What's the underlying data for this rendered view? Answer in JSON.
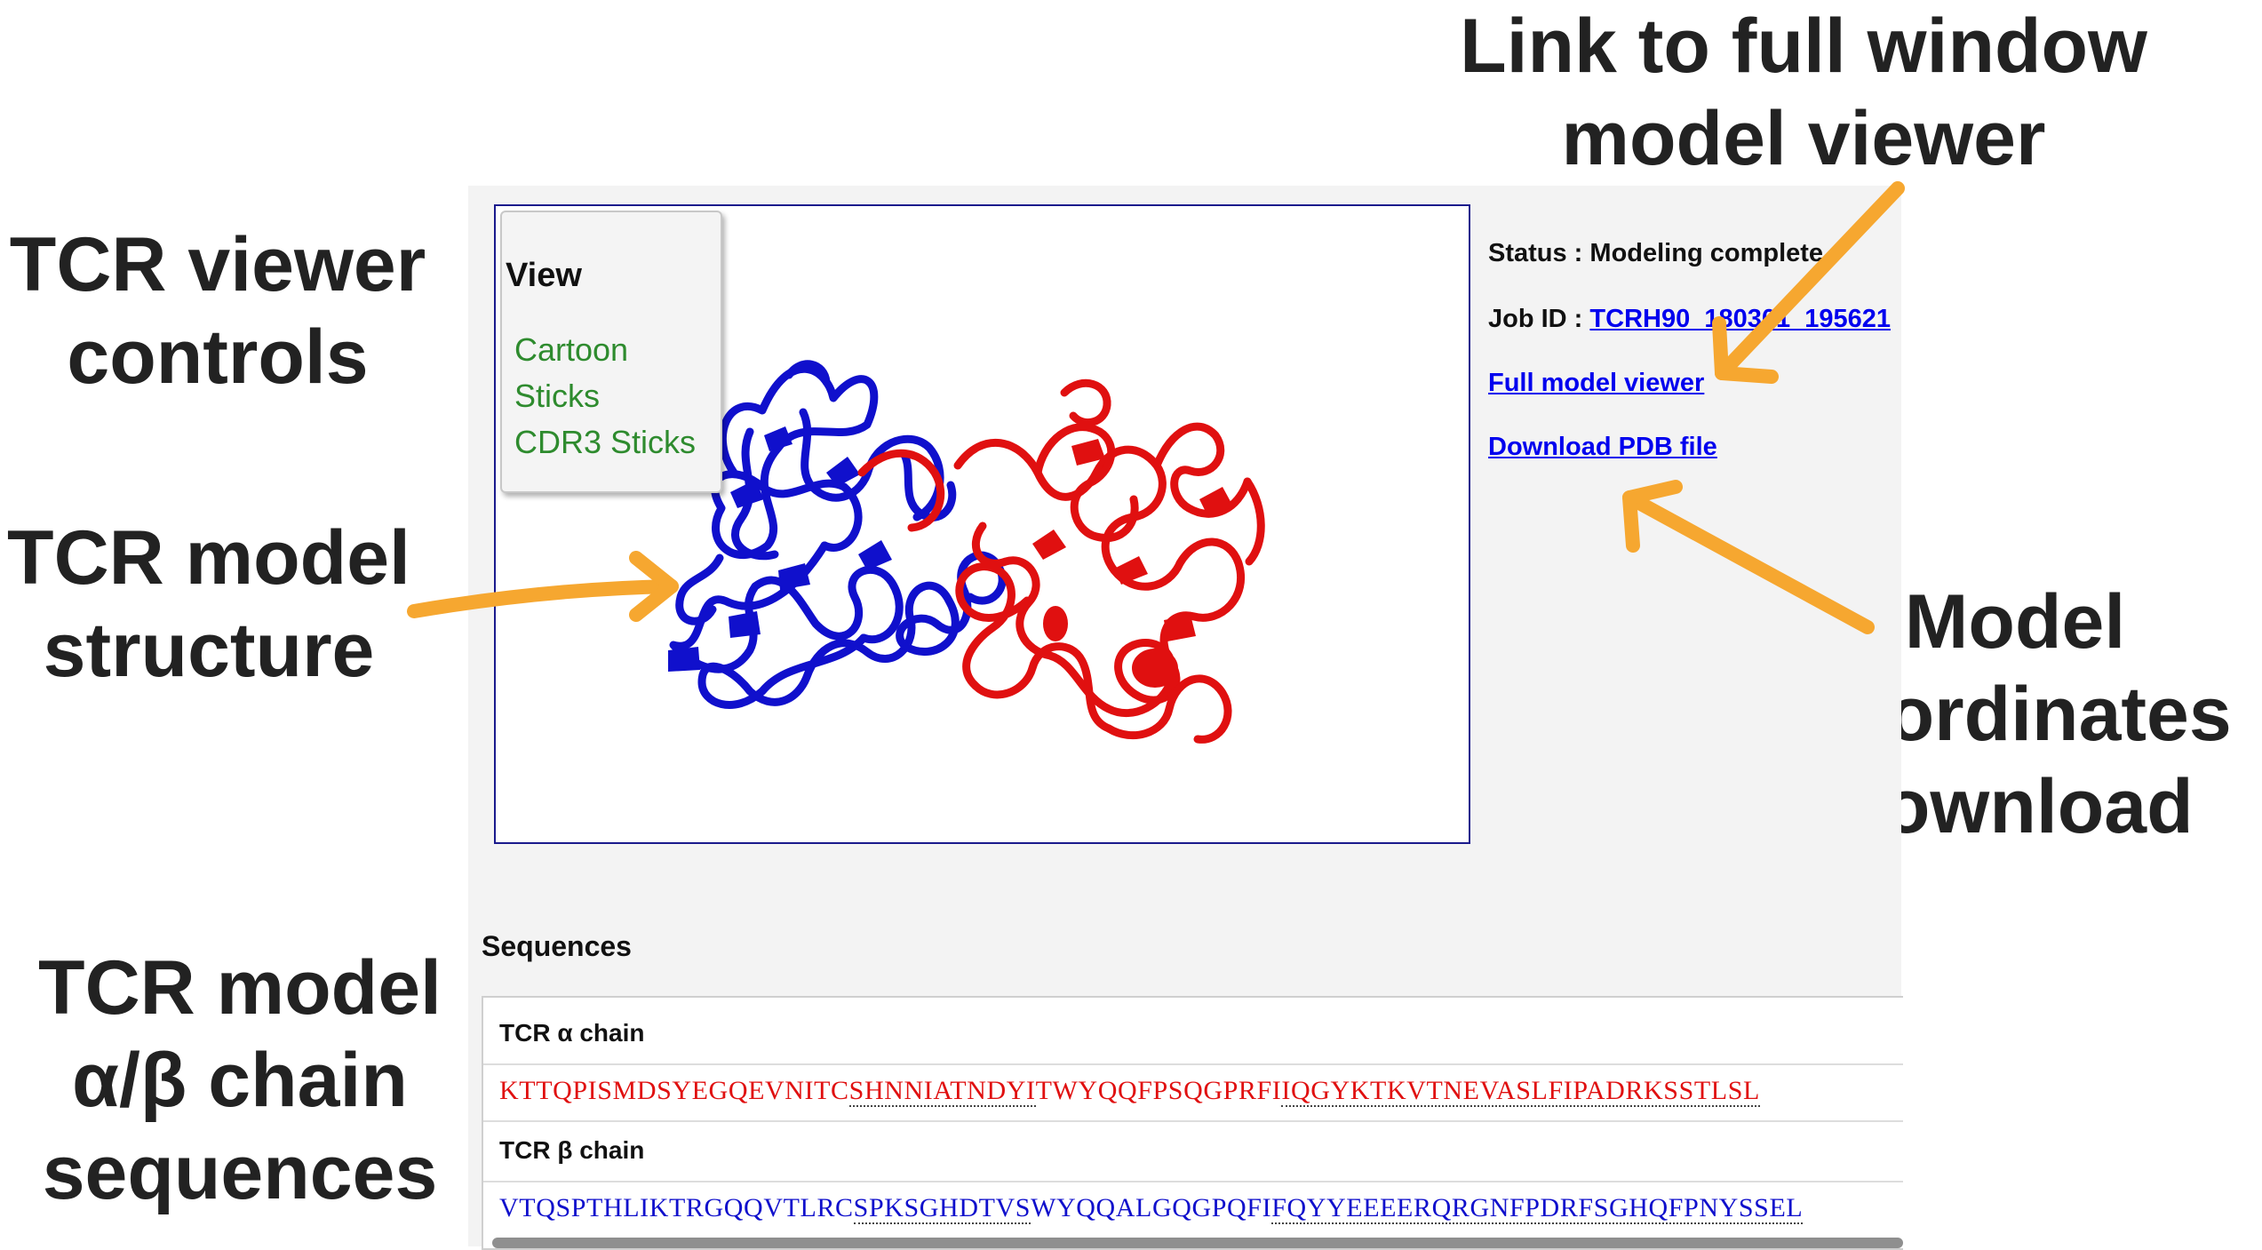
{
  "annotations": {
    "link_full_viewer": [
      "Link to full window",
      "model viewer"
    ],
    "viewer_controls": [
      "TCR viewer",
      "controls"
    ],
    "model_structure": [
      "TCR model",
      "structure"
    ],
    "coordinates_download": [
      "Model",
      "coordinates",
      "download"
    ],
    "chain_sequences": [
      "TCR model",
      "α/β chain",
      "sequences"
    ],
    "arrow_color": "#f6a730"
  },
  "viewer": {
    "controls": {
      "heading": "View",
      "options": [
        "Cartoon",
        "Sticks",
        "CDR3 Sticks"
      ]
    },
    "chain_colors": {
      "alpha": "#e01010",
      "beta": "#1010cc"
    }
  },
  "job": {
    "status_label": "Status :",
    "status_value": "Modeling complete",
    "job_id_label": "Job ID :",
    "job_id_value": "TCRH90_180301_195621",
    "full_viewer_link": "Full model viewer",
    "download_link": "Download PDB file"
  },
  "sequences": {
    "heading": "Sequences",
    "alpha": {
      "label": "TCR α chain",
      "parts": [
        "KTTQPISMDSYEGQEVNITC",
        "SHNNIATNDYI",
        "TWYQQFPSQGPRFI",
        "IQGYKTKVTNEVASLFIPADRKSSTLSL"
      ]
    },
    "beta": {
      "label": "TCR β chain",
      "parts": [
        "VTQSPTHLIKTRGQQVTLRC",
        "SPKSGHDTVS",
        "WYQQALGQGPQFI",
        "FQYYEEEERQRGNFPDRFSGHQFPNYSSEL"
      ]
    }
  }
}
